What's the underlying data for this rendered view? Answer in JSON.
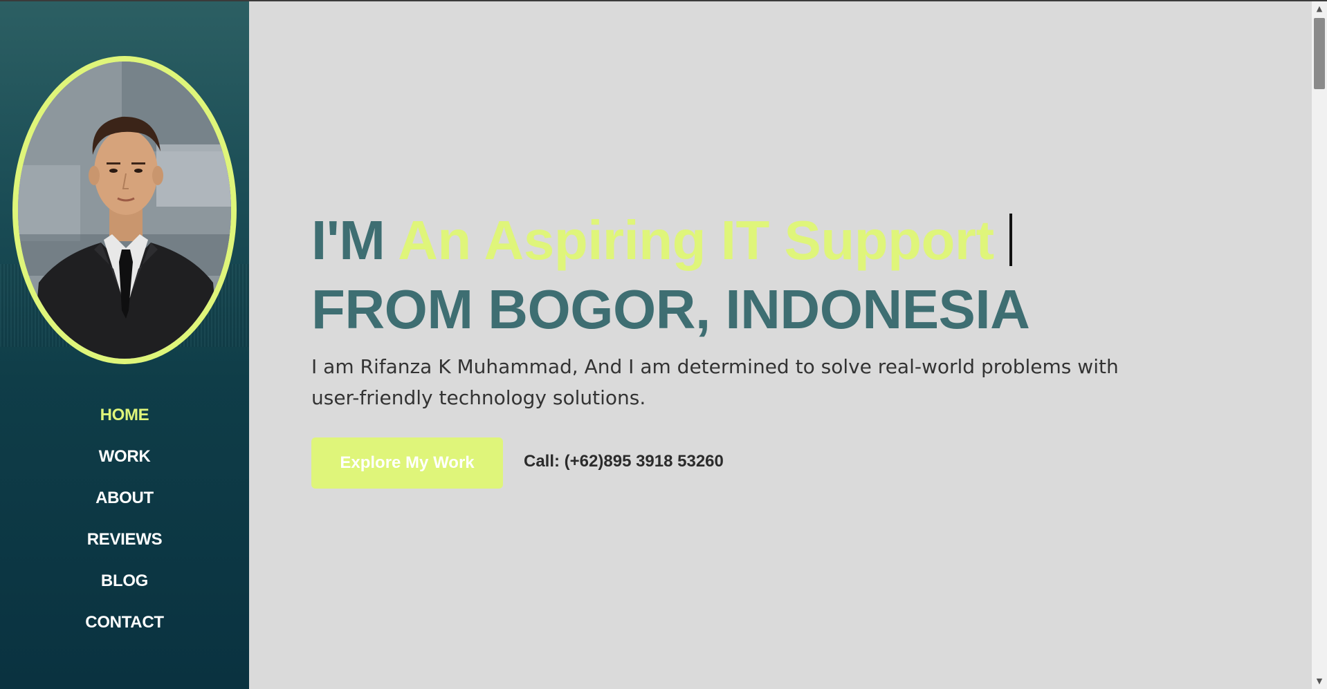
{
  "sidebar": {
    "avatar_alt": "Profile photo",
    "nav_items": [
      {
        "label": "HOME",
        "active": true
      },
      {
        "label": "WORK",
        "active": false
      },
      {
        "label": "ABOUT",
        "active": false
      },
      {
        "label": "REVIEWS",
        "active": false
      },
      {
        "label": "BLOG",
        "active": false
      },
      {
        "label": "CONTACT",
        "active": false
      }
    ]
  },
  "hero": {
    "prefix": "I'M",
    "typed_role": "An Aspiring IT Support",
    "line2": "FROM BOGOR, INDONESIA",
    "intro": "I am Rifanza K Muhammad, And I am determined to solve real-world problems with user-friendly technology solutions.",
    "cta_label": "Explore My Work",
    "call_text": "Call: (+62)895 3918 53260"
  },
  "colors": {
    "accent": "#dff57a",
    "heading": "#3e6e72",
    "sidebar_dark": "#0a3240",
    "background": "#dadada"
  },
  "icons": {
    "scroll_up": "triangle-up-icon",
    "scroll_down": "triangle-down-icon"
  }
}
